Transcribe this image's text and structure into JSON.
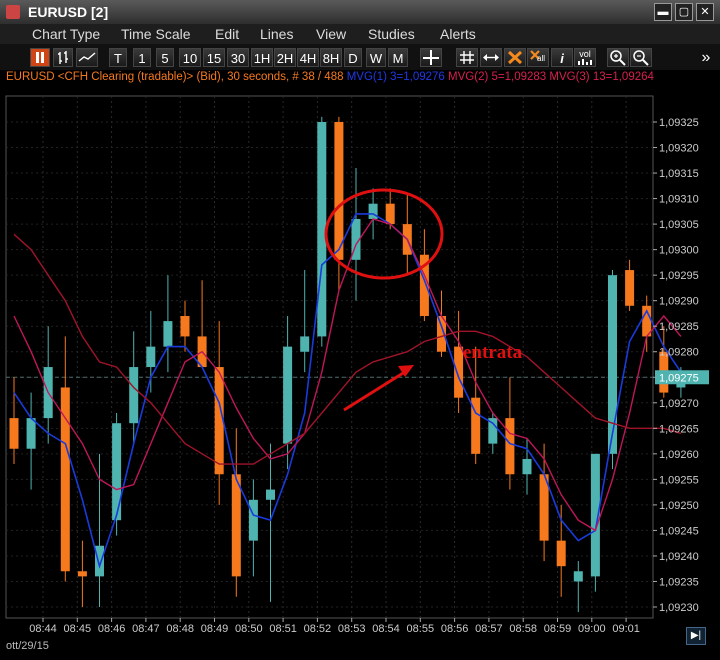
{
  "window": {
    "title": "EURUSD [2]",
    "min": "▬",
    "max": "▢",
    "close": "✕"
  },
  "menu": [
    "Chart Type",
    "Time Scale",
    "Edit",
    "Lines",
    "View",
    "Studies",
    "Alerts"
  ],
  "toolbar": {
    "periods": [
      "T",
      "1",
      "5",
      "10",
      "15",
      "30",
      "1H",
      "2H",
      "4H",
      "8H",
      "D",
      "W",
      "M"
    ],
    "icons": [
      "pause-icon",
      "bar-chart-icon",
      "line-chart-icon",
      "crosshair-icon",
      "grid-icon",
      "arrows-icon",
      "delete-all-icon",
      "delete-all-icon-2",
      "info-icon",
      "volume-icon",
      "zoom-in-icon",
      "zoom-out-icon",
      "more-icon"
    ],
    "delete_all_label": "all",
    "volume_label": "vol",
    "more_label": "»"
  },
  "info": {
    "symbol": "EURUSD <CFH Clearing (tradable)> (Bid), 30 seconds, # 38 / 488",
    "mvg1": "MVG(1) 3=1,09276",
    "mvg2": "MVG(2) 5=1,09283",
    "mvg3": "MVG(3) 13=1,09264"
  },
  "colors": {
    "bull": "#4fb3b0",
    "bear": "#f7791e",
    "mvg1": "#1a3bdc",
    "mvg2": "#c0165a",
    "mvg3": "#a0142a",
    "annotation": "#e01010",
    "price_tag": "#4fb3b0"
  },
  "annotation": {
    "label": "entrata"
  },
  "time_zone": "ott/29/15",
  "current_price": "1,09275",
  "chart_data": {
    "type": "candlestick",
    "title": "",
    "ylim": [
      1.09228,
      1.0933
    ],
    "y_ticks": [
      "1,09230",
      "1,09235",
      "1,09240",
      "1,09245",
      "1,09250",
      "1,09255",
      "1,09260",
      "1,09265",
      "1,09270",
      "1,09275",
      "1,09280",
      "1,09285",
      "1,09290",
      "1,09295",
      "1,09300",
      "1,09305",
      "1,09310",
      "1,09315",
      "1,09320",
      "1,09325"
    ],
    "x_ticks": [
      "08:44",
      "08:45",
      "08:46",
      "08:47",
      "08:48",
      "08:49",
      "08:50",
      "08:51",
      "08:52",
      "08:53",
      "08:54",
      "08:55",
      "08:56",
      "08:57",
      "08:58",
      "08:59",
      "09:00",
      "09:01"
    ],
    "candles": [
      {
        "o": 1.09267,
        "h": 1.09275,
        "l": 1.09258,
        "c": 1.09261
      },
      {
        "o": 1.09261,
        "h": 1.09272,
        "l": 1.09253,
        "c": 1.09267
      },
      {
        "o": 1.09267,
        "h": 1.09285,
        "l": 1.09262,
        "c": 1.09277
      },
      {
        "o": 1.09273,
        "h": 1.09283,
        "l": 1.09235,
        "c": 1.09237
      },
      {
        "o": 1.09237,
        "h": 1.09243,
        "l": 1.0923,
        "c": 1.09236
      },
      {
        "o": 1.09236,
        "h": 1.0926,
        "l": 1.0923,
        "c": 1.09242
      },
      {
        "o": 1.09247,
        "h": 1.09268,
        "l": 1.09244,
        "c": 1.09266
      },
      {
        "o": 1.09266,
        "h": 1.09284,
        "l": 1.09262,
        "c": 1.09277
      },
      {
        "o": 1.09277,
        "h": 1.09288,
        "l": 1.09272,
        "c": 1.09281
      },
      {
        "o": 1.09281,
        "h": 1.09295,
        "l": 1.09276,
        "c": 1.09286
      },
      {
        "o": 1.09287,
        "h": 1.0929,
        "l": 1.0928,
        "c": 1.09283
      },
      {
        "o": 1.09283,
        "h": 1.09294,
        "l": 1.09277,
        "c": 1.09277
      },
      {
        "o": 1.09277,
        "h": 1.09286,
        "l": 1.0925,
        "c": 1.09256
      },
      {
        "o": 1.09256,
        "h": 1.09265,
        "l": 1.09232,
        "c": 1.09236
      },
      {
        "o": 1.09243,
        "h": 1.09255,
        "l": 1.09236,
        "c": 1.09251
      },
      {
        "o": 1.09251,
        "h": 1.09262,
        "l": 1.09231,
        "c": 1.09253
      },
      {
        "o": 1.09262,
        "h": 1.09287,
        "l": 1.09257,
        "c": 1.09281
      },
      {
        "o": 1.0928,
        "h": 1.09296,
        "l": 1.09276,
        "c": 1.09283
      },
      {
        "o": 1.09283,
        "h": 1.09326,
        "l": 1.09281,
        "c": 1.09325
      },
      {
        "o": 1.09325,
        "h": 1.09326,
        "l": 1.09292,
        "c": 1.09298
      },
      {
        "o": 1.09298,
        "h": 1.09316,
        "l": 1.0929,
        "c": 1.09306
      },
      {
        "o": 1.09306,
        "h": 1.09312,
        "l": 1.09302,
        "c": 1.09309
      },
      {
        "o": 1.09309,
        "h": 1.09312,
        "l": 1.09304,
        "c": 1.09305
      },
      {
        "o": 1.09305,
        "h": 1.09311,
        "l": 1.09295,
        "c": 1.09299
      },
      {
        "o": 1.09299,
        "h": 1.09304,
        "l": 1.09286,
        "c": 1.09287
      },
      {
        "o": 1.09287,
        "h": 1.09292,
        "l": 1.09279,
        "c": 1.0928
      },
      {
        "o": 1.09281,
        "h": 1.09288,
        "l": 1.09268,
        "c": 1.09271
      },
      {
        "o": 1.09271,
        "h": 1.09281,
        "l": 1.09258,
        "c": 1.0926
      },
      {
        "o": 1.09262,
        "h": 1.09268,
        "l": 1.0926,
        "c": 1.09267
      },
      {
        "o": 1.09267,
        "h": 1.09275,
        "l": 1.09253,
        "c": 1.09256
      },
      {
        "o": 1.09256,
        "h": 1.09263,
        "l": 1.09252,
        "c": 1.09259
      },
      {
        "o": 1.09256,
        "h": 1.09262,
        "l": 1.09239,
        "c": 1.09243
      },
      {
        "o": 1.09243,
        "h": 1.0925,
        "l": 1.09232,
        "c": 1.09238
      },
      {
        "o": 1.09235,
        "h": 1.09239,
        "l": 1.09229,
        "c": 1.09237
      },
      {
        "o": 1.09236,
        "h": 1.0926,
        "l": 1.09233,
        "c": 1.0926
      },
      {
        "o": 1.0926,
        "h": 1.09296,
        "l": 1.09257,
        "c": 1.09295
      },
      {
        "o": 1.09296,
        "h": 1.09298,
        "l": 1.09288,
        "c": 1.09289
      },
      {
        "o": 1.09289,
        "h": 1.09291,
        "l": 1.0928,
        "c": 1.09283
      },
      {
        "o": 1.0928,
        "h": 1.09285,
        "l": 1.09271,
        "c": 1.09272
      },
      {
        "o": 1.09273,
        "h": 1.09277,
        "l": 1.09271,
        "c": 1.09275
      }
    ],
    "series": [
      {
        "name": "MVG(1) 3",
        "values": [
          1.09272,
          1.09267,
          1.09264,
          1.09262,
          1.09251,
          1.09238,
          1.09248,
          1.09262,
          1.09275,
          1.09281,
          1.09281,
          1.09277,
          1.0927,
          1.09255,
          1.09248,
          1.09247,
          1.09256,
          1.09268,
          1.09297,
          1.093,
          1.09307,
          1.09307,
          1.09305,
          1.09302,
          1.09294,
          1.09285,
          1.09275,
          1.09268,
          1.09266,
          1.09262,
          1.09261,
          1.09256,
          1.09247,
          1.09243,
          1.09245,
          1.09264,
          1.09282,
          1.09288,
          1.09281,
          1.09276
        ]
      },
      {
        "name": "MVG(2) 5",
        "values": [
          1.09287,
          1.0928,
          1.09272,
          1.09267,
          1.09262,
          1.09255,
          1.09253,
          1.09254,
          1.09262,
          1.0927,
          1.09278,
          1.0928,
          1.09276,
          1.09269,
          1.09263,
          1.09259,
          1.0926,
          1.09264,
          1.09276,
          1.09292,
          1.09301,
          1.09306,
          1.09305,
          1.09302,
          1.09295,
          1.09287,
          1.09282,
          1.09274,
          1.09268,
          1.09264,
          1.09263,
          1.09259,
          1.09252,
          1.09247,
          1.09245,
          1.09255,
          1.09268,
          1.09283,
          1.09287,
          1.09283
        ]
      },
      {
        "name": "MVG(3) 13",
        "values": [
          1.09303,
          1.093,
          1.09295,
          1.0929,
          1.09283,
          1.09278,
          1.09277,
          1.09273,
          1.0927,
          1.09266,
          1.09262,
          1.0926,
          1.09258,
          1.09258,
          1.09258,
          1.0926,
          1.09262,
          1.09264,
          1.09268,
          1.09272,
          1.09276,
          1.09278,
          1.09279,
          1.0928,
          1.09282,
          1.09283,
          1.09284,
          1.09284,
          1.09283,
          1.09281,
          1.09279,
          1.09276,
          1.09273,
          1.0927,
          1.09267,
          1.09266,
          1.09265,
          1.09265,
          1.09265,
          1.09264
        ]
      }
    ]
  }
}
